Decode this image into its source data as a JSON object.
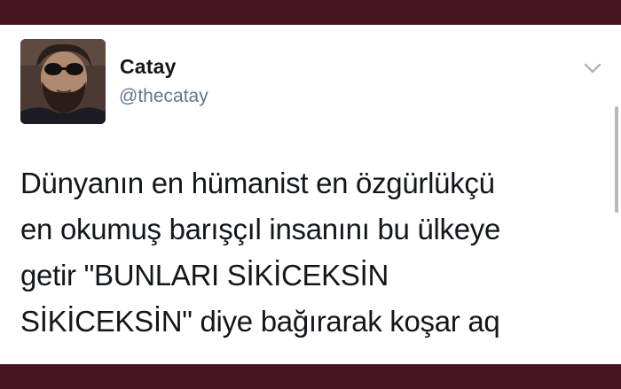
{
  "tweet": {
    "author": {
      "display_name": "Catay",
      "handle": "@thecatay",
      "avatar_icon": "profile-photo"
    },
    "menu_icon": "chevron-down-icon",
    "text_lines": [
      "Dünyanın en hümanist en özgürlükçü",
      "en okumuş barışçıl insanını bu ülkeye",
      "getir \"BUNLARI SİKİCEKSİN",
      "SİKİCEKSİN\" diye bağırarak koşar aq"
    ]
  },
  "colors": {
    "frame": "#471521",
    "card_background": "#ffffff",
    "text_primary": "#14171a",
    "text_secondary": "#657786",
    "chevron": "#aab8c2"
  }
}
